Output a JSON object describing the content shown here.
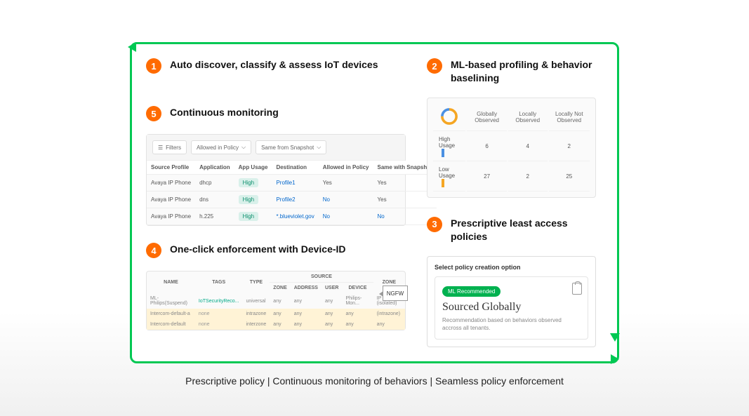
{
  "steps": {
    "s1": {
      "num": "1",
      "title": "Auto discover, classify & assess IoT devices"
    },
    "s2": {
      "num": "2",
      "title": "ML-based profiling & behavior baselining"
    },
    "s3": {
      "num": "3",
      "title": "Prescriptive least access policies"
    },
    "s4": {
      "num": "4",
      "title": "One-click enforcement with Device-ID"
    },
    "s5": {
      "num": "5",
      "title": "Continuous monitoring"
    }
  },
  "monitor": {
    "filters_label": "Filters",
    "dd1": "Allowed in Policy",
    "dd2": "Same from Snapshot",
    "headers": {
      "src": "Source Profile",
      "app": "Application",
      "usage": "App Usage",
      "dest": "Destination",
      "allowed": "Allowed in Policy",
      "snap": "Same with Snapshot"
    },
    "rows": [
      {
        "src": "Avaya IP Phone",
        "app": "dhcp",
        "usage": "High",
        "dest": "Profile1",
        "allowed": "Yes",
        "snap": "Yes"
      },
      {
        "src": "Avaya IP Phone",
        "app": "dns",
        "usage": "High",
        "dest": "Profile2",
        "allowed": "No",
        "snap": "Yes"
      },
      {
        "src": "Avaya IP Phone",
        "app": "h.225",
        "usage": "High",
        "dest": "*.blueviolet.gov",
        "allowed": "No",
        "snap": "No"
      }
    ]
  },
  "ml": {
    "headers": {
      "globally": "Globally Observed",
      "locally": "Locally Observed",
      "not": "Locally Not Observed"
    },
    "rows": [
      {
        "label": "High Usage",
        "g": "6",
        "l": "4",
        "n": "2",
        "color": "blue"
      },
      {
        "label": "Low Usage",
        "g": "27",
        "l": "2",
        "n": "25",
        "color": "orange"
      }
    ]
  },
  "policy": {
    "select_label": "Select policy creation option",
    "badge": "ML Recommended",
    "title": "Sourced Globally",
    "desc": "Recommendation based on behaviors observed accross all tenants."
  },
  "enforce": {
    "source_group": "Source",
    "headers": {
      "name": "NAME",
      "tags": "TAGS",
      "type": "TYPE",
      "zone": "ZONE",
      "address": "ADDRESS",
      "user": "USER",
      "device": "DEVICE",
      "zone2": "ZONE"
    },
    "ngfw": "NGFW",
    "rows": [
      {
        "name": "ML-Philips(Suspend)",
        "tags": "IoTSecurityReco...",
        "type": "universal",
        "zone": "any",
        "address": "any",
        "user": "any",
        "device": "Philips-Mon...",
        "zone2": "IP (isolated)"
      },
      {
        "name": "Intercom-default-a",
        "tags": "none",
        "type": "intrazone",
        "zone": "any",
        "address": "any",
        "user": "any",
        "device": "any",
        "zone2": "(intrazone)"
      },
      {
        "name": "Intercom-default",
        "tags": "none",
        "type": "interzone",
        "zone": "any",
        "address": "any",
        "user": "any",
        "device": "any",
        "zone2": "any"
      }
    ]
  },
  "caption": "Prescriptive policy | Continuous monitoring of behaviors | Seamless policy enforcement"
}
